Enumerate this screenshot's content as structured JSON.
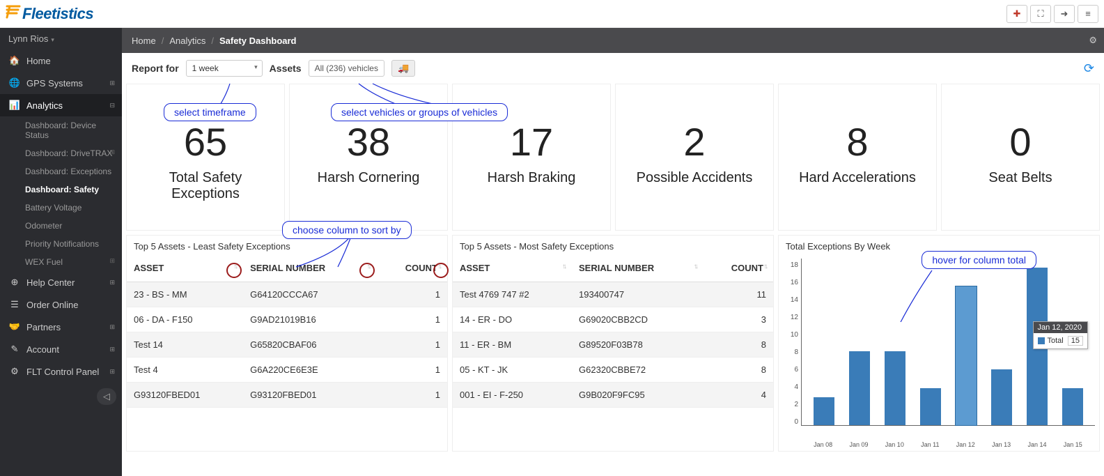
{
  "brand": "Fleetistics",
  "user": "Lynn Rios",
  "sidebar": {
    "items": [
      {
        "icon": "home",
        "label": "Home"
      },
      {
        "icon": "globe",
        "label": "GPS Systems",
        "expand": true
      },
      {
        "icon": "bars",
        "label": "Analytics",
        "expand": true,
        "active": true
      },
      {
        "icon": "life",
        "label": "Help Center",
        "expand": true
      },
      {
        "icon": "list",
        "label": "Order Online"
      },
      {
        "icon": "hands",
        "label": "Partners",
        "expand": true
      },
      {
        "icon": "edit",
        "label": "Account",
        "expand": true
      },
      {
        "icon": "cogs",
        "label": "FLT Control Panel",
        "expand": true
      }
    ],
    "sub": [
      {
        "label": "Dashboard: Device Status"
      },
      {
        "label": "Dashboard: DriveTRAX",
        "expand": true
      },
      {
        "label": "Dashboard: Exceptions"
      },
      {
        "label": "Dashboard: Safety",
        "active": true
      },
      {
        "label": "Battery Voltage"
      },
      {
        "label": "Odometer"
      },
      {
        "label": "Priority Notifications"
      },
      {
        "label": "WEX Fuel",
        "expand": true
      }
    ]
  },
  "breadcrumb": {
    "home": "Home",
    "analytics": "Analytics",
    "current": "Safety Dashboard"
  },
  "toolbar": {
    "report_for": "Report for",
    "timeframe": "1 week",
    "assets_label": "Assets",
    "assets_value": "All (236) vehicles"
  },
  "callouts": {
    "timeframe": "select timeframe",
    "vehicles": "select vehicles or groups of vehicles",
    "sort": "choose column to sort by",
    "hover": "hover for column total"
  },
  "kpis": [
    {
      "value": "65",
      "label": "Total Safety Exceptions"
    },
    {
      "value": "38",
      "label": "Harsh Cornering"
    },
    {
      "value": "17",
      "label": "Harsh Braking"
    },
    {
      "value": "2",
      "label": "Possible Accidents"
    },
    {
      "value": "8",
      "label": "Hard Accelerations"
    },
    {
      "value": "0",
      "label": "Seat Belts"
    }
  ],
  "table_headers": {
    "asset": "ASSET",
    "serial": "SERIAL NUMBER",
    "count": "COUNT"
  },
  "least": {
    "title": "Top 5 Assets - Least Safety Exceptions",
    "rows": [
      {
        "asset": "23 - BS - MM",
        "serial": "G64120CCCA67",
        "count": "1"
      },
      {
        "asset": "06 - DA - F150",
        "serial": "G9AD21019B16",
        "count": "1"
      },
      {
        "asset": "Test 14",
        "serial": "G65820CBAF06",
        "count": "1"
      },
      {
        "asset": "Test 4",
        "serial": "G6A220CE6E3E",
        "count": "1"
      },
      {
        "asset": "G93120FBED01",
        "serial": "G93120FBED01",
        "count": "1"
      }
    ]
  },
  "most": {
    "title": "Top 5 Assets - Most Safety Exceptions",
    "rows": [
      {
        "asset": "Test 4769 747 #2",
        "serial": "193400747",
        "count": "11"
      },
      {
        "asset": "14 - ER - DO",
        "serial": "G69020CBB2CD",
        "count": "3"
      },
      {
        "asset": "11 - ER - BM",
        "serial": "G89520F03B78",
        "count": "8"
      },
      {
        "asset": "05 - KT - JK",
        "serial": "G62320CBBE72",
        "count": "8"
      },
      {
        "asset": "001 - EI - F-250",
        "serial": "G9B020F9FC95",
        "count": "4"
      }
    ]
  },
  "chart_title": "Total Exceptions By Week",
  "tooltip": {
    "date": "Jan 12, 2020",
    "series": "Total",
    "value": "15"
  },
  "chart_data": {
    "type": "bar",
    "title": "Total Exceptions By Week",
    "categories": [
      "Jan 08",
      "Jan 09",
      "Jan 10",
      "Jan 11",
      "Jan 12",
      "Jan 13",
      "Jan 14",
      "Jan 15"
    ],
    "series": [
      {
        "name": "Total",
        "values": [
          3,
          8,
          8,
          4,
          15,
          6,
          17,
          4
        ]
      }
    ],
    "ylim": [
      0,
      18
    ],
    "y_ticks": [
      0,
      2,
      4,
      6,
      8,
      10,
      12,
      14,
      16,
      18
    ],
    "highlight_index": 4,
    "xlabel": "",
    "ylabel": ""
  }
}
